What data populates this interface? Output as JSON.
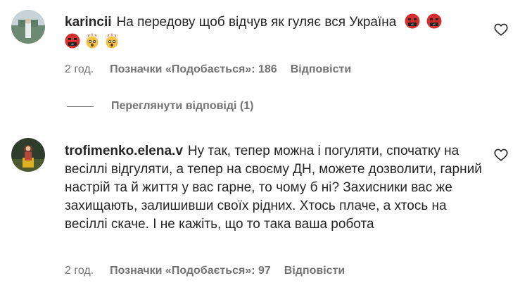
{
  "comments": [
    {
      "username": "karinciі",
      "text": "На передову щоб відчув як гуляє вся Україна",
      "emojis": [
        "face-with-symbols-on-mouth",
        "face-with-symbols-on-mouth",
        "face-with-symbols-on-mouth",
        "exploding-head",
        "exploding-head"
      ],
      "time": "2 год.",
      "likes": "Позначки «Подобається»: 186",
      "reply": "Відповісти",
      "view_replies": "Переглянути відповіді (1)"
    },
    {
      "username": "trofimenko.elena.v",
      "text": "Ну так, тепер можна і погуляти, спочатку на весіллі відгуляти, а тепер на своєму ДН, можете дозволити, гарний настрій та й життя у вас гарне, то чому б ні? Захисники вас же захищають, залишивши своїх рідних. Хтось плаче, а хтось на весіллі скаче. І не кажіть, що то така ваша робота",
      "time": "2 год.",
      "likes": "Позначки «Подобається»: 97",
      "reply": "Відповісти"
    }
  ],
  "icons": {
    "like": "heart-outline-icon"
  },
  "colors": {
    "text": "#262626",
    "secondary": "#737373",
    "background": "#ffffff"
  }
}
